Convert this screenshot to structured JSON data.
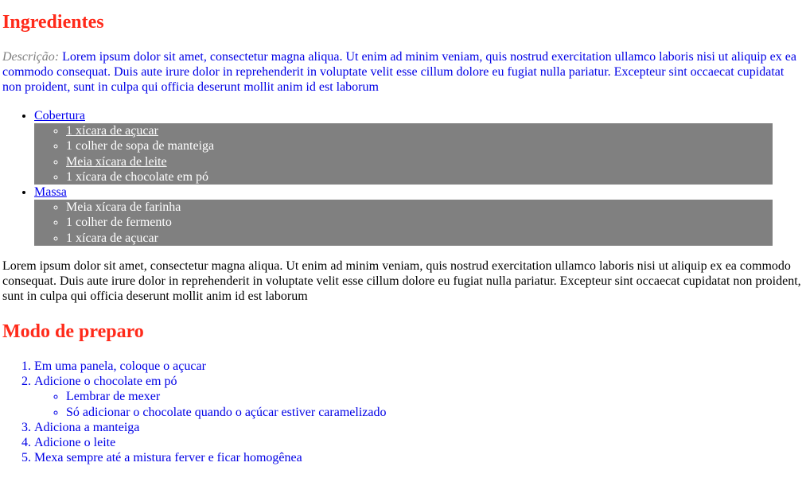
{
  "ingredientes": {
    "title": "Ingredientes",
    "description_label": "Descrição:",
    "description_text": " Lorem ipsum dolor sit amet, consectetur magna aliqua. Ut enim ad minim veniam, quis nostrud exercitation ullamco laboris nisi ut aliquip ex ea commodo consequat. Duis aute irure dolor in reprehenderit in voluptate velit esse cillum dolore eu fugiat nulla pariatur. Excepteur sint occaecat cupidatat non proident, sunt in culpa qui officia deserunt mollit anim id est laborum",
    "groups": [
      {
        "name": "Cobertura",
        "items": [
          {
            "text": "1 xícara de açucar",
            "link": true
          },
          {
            "text": "1 colher de sopa de manteiga",
            "link": false
          },
          {
            "text": "Meia xícara de leite",
            "link": true
          },
          {
            "text": "1 xícara de chocolate em pó",
            "link": false
          }
        ]
      },
      {
        "name": "Massa",
        "items": [
          {
            "text": "Meia xícara de farinha",
            "link": false
          },
          {
            "text": "1 colher de fermento",
            "link": false
          },
          {
            "text": "1 xícara de açucar",
            "link": false
          }
        ]
      }
    ]
  },
  "paragraph": "Lorem ipsum dolor sit amet, consectetur magna aliqua. Ut enim ad minim veniam, quis nostrud exercitation ullamco laboris nisi ut aliquip ex ea commodo consequat. Duis aute irure dolor in reprehenderit in voluptate velit esse cillum dolore eu fugiat nulla pariatur. Excepteur sint occaecat cupidatat non proident, sunt in culpa qui officia deserunt mollit anim id est laborum",
  "preparo": {
    "title": "Modo de preparo",
    "steps": [
      {
        "text": "Em uma panela, coloque o açucar"
      },
      {
        "text": "Adicione o chocolate em pó",
        "substeps": [
          "Lembrar de mexer",
          "Só adicionar o chocolate quando o açúcar estiver caramelizado"
        ]
      },
      {
        "text": "Adiciona a manteiga"
      },
      {
        "text": "Adicione o leite"
      },
      {
        "text": "Mexa sempre até a mistura ferver e ficar homogênea"
      }
    ]
  },
  "colors": {
    "heading": "#ff2a1a",
    "description_text": "#0000e6",
    "description_label": "#808080",
    "sublist_background": "#808080",
    "sublist_text": "#ffffff",
    "link": "#0000ee"
  }
}
